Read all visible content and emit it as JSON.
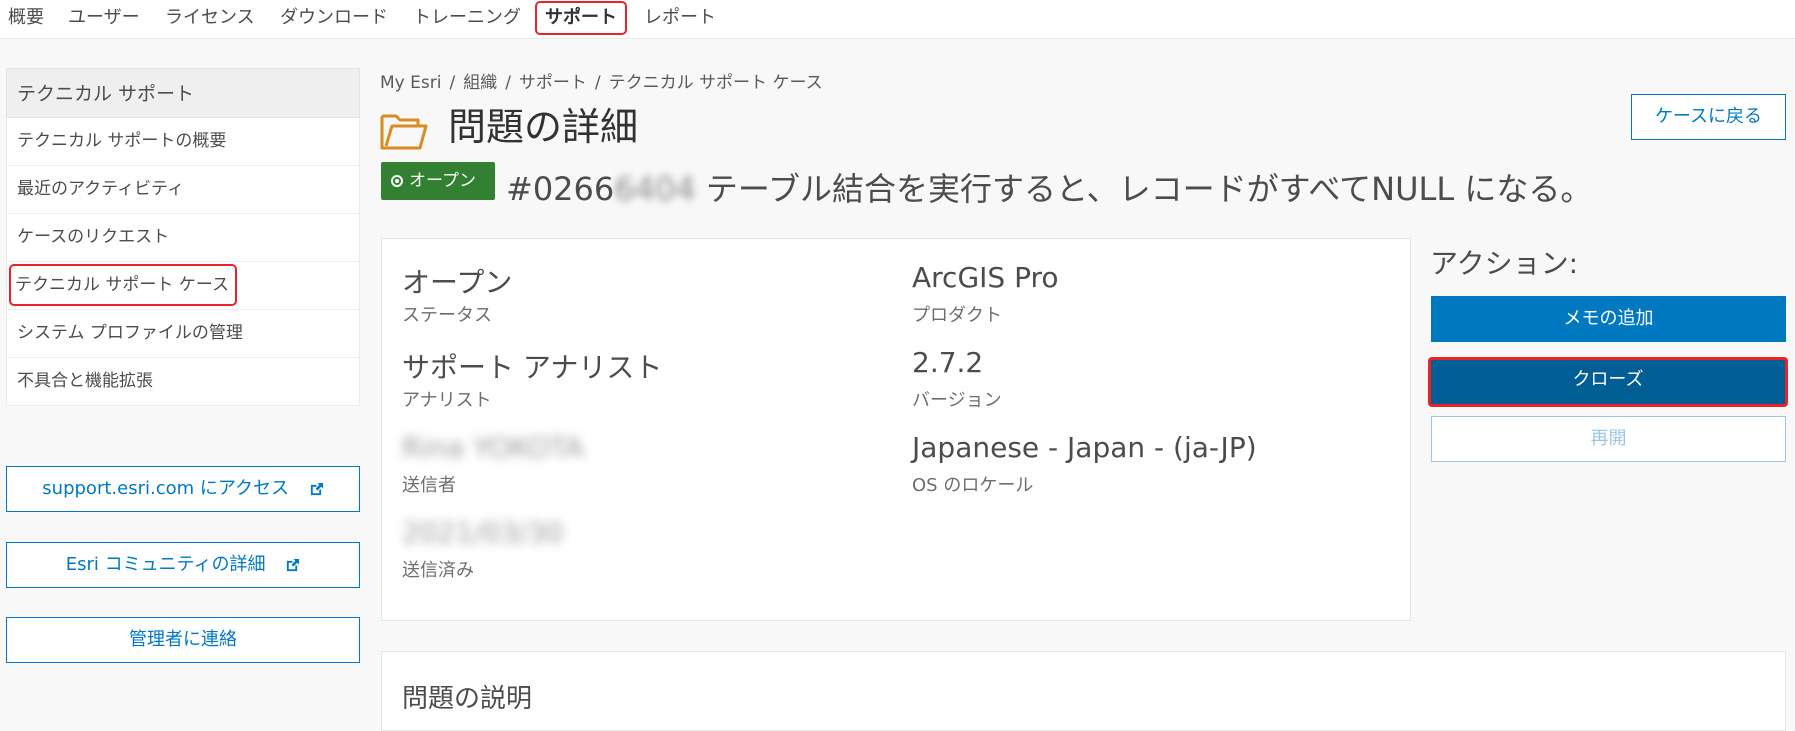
{
  "topnav": {
    "tabs": [
      {
        "label": "概要"
      },
      {
        "label": "ユーザー"
      },
      {
        "label": "ライセンス"
      },
      {
        "label": "ダウンロード"
      },
      {
        "label": "トレーニング"
      },
      {
        "label": "サポート",
        "active": true
      },
      {
        "label": "レポート"
      }
    ]
  },
  "sidebar": {
    "header": "テクニカル サポート",
    "items": [
      {
        "label": "テクニカル サポートの概要"
      },
      {
        "label": "最近のアクティビティ"
      },
      {
        "label": "ケースのリクエスト"
      },
      {
        "label": "テクニカル サポート ケース",
        "current": true
      },
      {
        "label": "システム プロファイルの管理"
      },
      {
        "label": "不具合と機能拡張"
      }
    ],
    "links": {
      "support": "support.esri.com にアクセス",
      "community": "Esri コミュニティの詳細",
      "contact_admin": "管理者に連絡"
    }
  },
  "breadcrumb": [
    "My Esri",
    "組織",
    "サポート",
    "テクニカル サポート ケース"
  ],
  "breadcrumb_sep": "/",
  "page": {
    "title": "問題の詳細",
    "back_button": "ケースに戻る",
    "status_pill": "オープン",
    "case_number_prefix": "#0266",
    "case_number_hidden": "6404",
    "case_title": "テーブル結合を実行すると、レコードがすべてNULL になる。"
  },
  "details": {
    "status": {
      "value": "オープン",
      "label": "ステータス"
    },
    "analyst": {
      "value": "サポート アナリスト",
      "label": "アナリスト"
    },
    "submitter": {
      "value": "Rina YOKOTA",
      "label": "送信者"
    },
    "submitted": {
      "value": "2021/03/30",
      "label": "送信済み"
    },
    "product": {
      "value": "ArcGIS Pro",
      "label": "プロダクト"
    },
    "version": {
      "value": "2.7.2",
      "label": "バージョン"
    },
    "locale": {
      "value": "Japanese - Japan - (ja-JP)",
      "label": "OS のロケール"
    }
  },
  "actions": {
    "title": "アクション:",
    "add_memo": "メモの追加",
    "close": "クローズ",
    "reopen": "再開"
  },
  "description": {
    "title": "問題の説明"
  },
  "colors": {
    "brand_blue": "#0079c1",
    "dark_blue": "#005e95",
    "status_green": "#338033",
    "highlight_red": "#e8242a",
    "folder_orange": "#d98c1f"
  }
}
